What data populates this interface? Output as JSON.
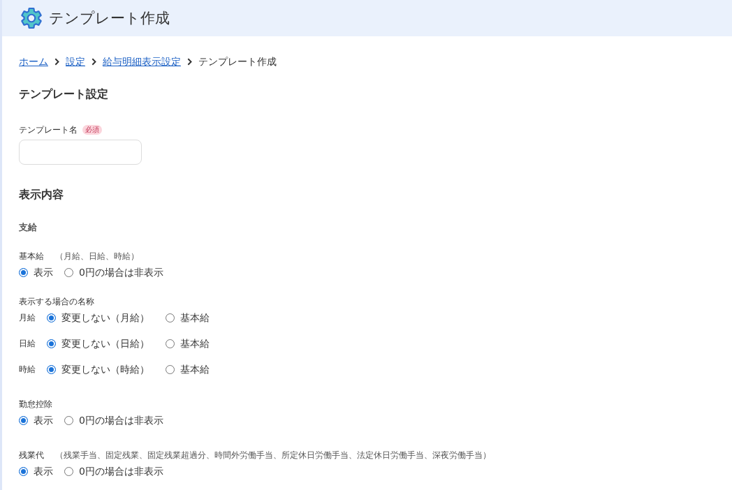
{
  "header": {
    "title": "テンプレート作成"
  },
  "breadcrumb": [
    {
      "label": "ホーム",
      "kind": "link"
    },
    {
      "label": "設定",
      "kind": "link"
    },
    {
      "label": "給与明細表示設定",
      "kind": "link"
    },
    {
      "label": "テンプレート作成",
      "kind": "current"
    }
  ],
  "template_settings": {
    "heading": "テンプレート設定",
    "name_field": {
      "label": "テンプレート名",
      "badge": "必須"
    }
  },
  "display_content": {
    "heading": "表示内容",
    "group": "支給",
    "items": [
      {
        "kind": "visibility",
        "label": "基本給",
        "note": "（月給、日給、時給）",
        "options": [
          {
            "label": "表示",
            "selected": true
          },
          {
            "label": "0円の場合は非表示",
            "selected": false
          }
        ]
      },
      {
        "kind": "naming",
        "label": "表示する場合の名称",
        "rows": [
          {
            "label": "月給",
            "options": [
              {
                "label": "変更しない（月給）",
                "selected": true
              },
              {
                "label": "基本給",
                "selected": false
              }
            ]
          },
          {
            "label": "日給",
            "options": [
              {
                "label": "変更しない（日給）",
                "selected": true
              },
              {
                "label": "基本給",
                "selected": false
              }
            ]
          },
          {
            "label": "時給",
            "options": [
              {
                "label": "変更しない（時給）",
                "selected": true
              },
              {
                "label": "基本給",
                "selected": false
              }
            ]
          }
        ]
      },
      {
        "kind": "visibility",
        "label": "勤怠控除",
        "options": [
          {
            "label": "表示",
            "selected": true
          },
          {
            "label": "0円の場合は非表示",
            "selected": false
          }
        ]
      },
      {
        "kind": "visibility",
        "label": "残業代",
        "note": "（残業手当、固定残業、固定残業超過分、時間外労働手当、所定休日労働手当、法定休日労働手当、深夜労働手当）",
        "options": [
          {
            "label": "表示",
            "selected": true
          },
          {
            "label": "0円の場合は非表示",
            "selected": false
          }
        ]
      }
    ]
  }
}
